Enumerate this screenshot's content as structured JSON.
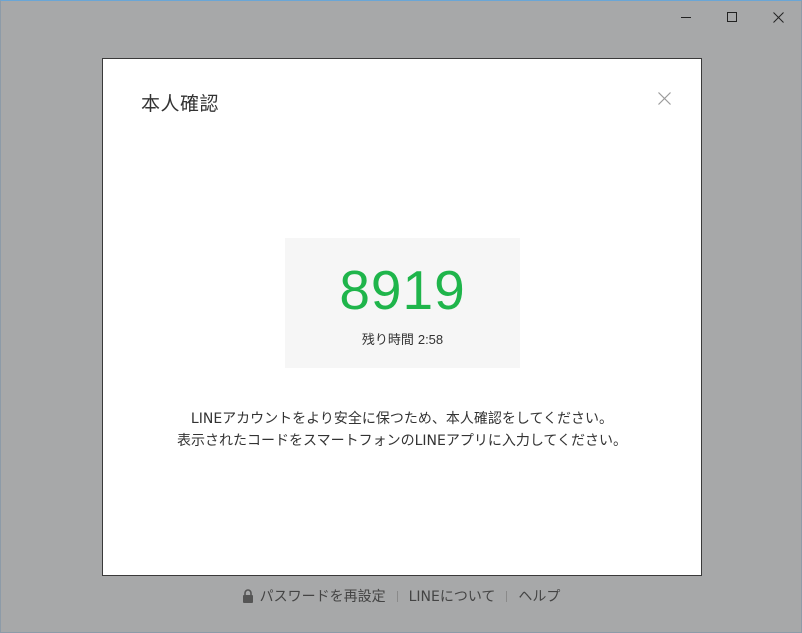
{
  "window": {
    "controls": [
      "minimize",
      "maximize",
      "close"
    ]
  },
  "dialog": {
    "title": "本人確認",
    "code": "8919",
    "timer_label": "残り時間",
    "timer_value": "2:58",
    "instruction_line1": "LINEアカウントをより安全に保つため、本人確認をしてください。",
    "instruction_line2": "表示されたコードをスマートフォンのLINEアプリに入力してください。"
  },
  "footer": {
    "reset_password": "パスワードを再設定",
    "about_line": "LINEについて",
    "help": "ヘルプ"
  },
  "colors": {
    "code": "#1fb54b",
    "overlay": "#a7a8a9",
    "code_box": "#f6f6f6"
  },
  "icons": {
    "reset_password": "lock-icon",
    "dialog_close": "close-icon"
  }
}
